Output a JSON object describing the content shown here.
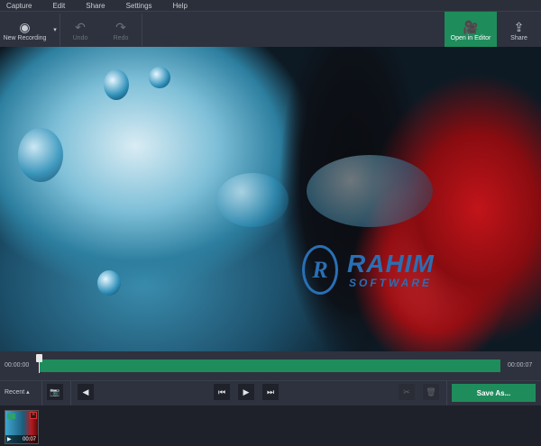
{
  "menu": [
    "Capture",
    "Edit",
    "Share",
    "Settings",
    "Help"
  ],
  "toolbar": {
    "new_recording": "New Recording",
    "undo": "Undo",
    "redo": "Redo",
    "open_in_editor": "Open in Editor",
    "share": "Share"
  },
  "watermark": {
    "logo": "R",
    "title": "RAHIM",
    "subtitle": "SOFTWARE"
  },
  "timeline": {
    "start": "00:00:00",
    "end": "00:00:07",
    "position": 0
  },
  "controls": {
    "recent": "Recent",
    "save_as": "Save As..."
  },
  "recent": [
    {
      "duration": "00:07"
    }
  ],
  "colors": {
    "accent": "#1f8c5c",
    "background": "#2e323e"
  }
}
